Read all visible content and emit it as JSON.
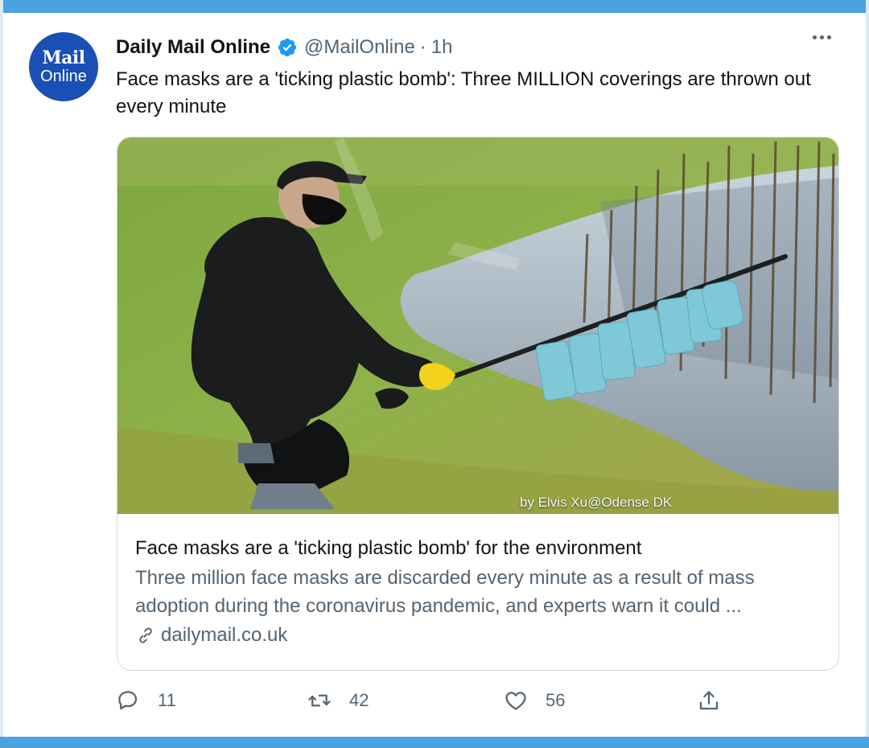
{
  "tweet": {
    "avatar": {
      "line1": "Mail",
      "line2": "Online",
      "color": "#1a4fb5"
    },
    "display_name": "Daily Mail Online",
    "verified_icon": "verified-badge-icon",
    "handle": "@MailOnline",
    "separator": "·",
    "time": "1h",
    "more_icon": "more-horizontal-icon",
    "text": "Face masks are a 'ticking plastic bomb': Three MILLION coverings are thrown out every minute"
  },
  "card": {
    "image_credit": "by Elvis Xu@Odense DK",
    "title": "Face masks are a 'ticking plastic bomb' for the environment",
    "description": "Three million face masks are discarded every minute as a result of mass adoption during the coronavirus pandemic, and experts warn it could ...",
    "link_icon": "link-icon",
    "domain": "dailymail.co.uk"
  },
  "actions": {
    "reply": {
      "icon": "reply-icon",
      "count": "11"
    },
    "retweet": {
      "icon": "retweet-icon",
      "count": "42"
    },
    "like": {
      "icon": "heart-icon",
      "count": "56"
    },
    "share": {
      "icon": "share-icon"
    }
  },
  "colors": {
    "frame": "#4aa3df",
    "verified": "#1d9bf0",
    "secondary_text": "#536471",
    "card_border": "#cfd9de"
  }
}
